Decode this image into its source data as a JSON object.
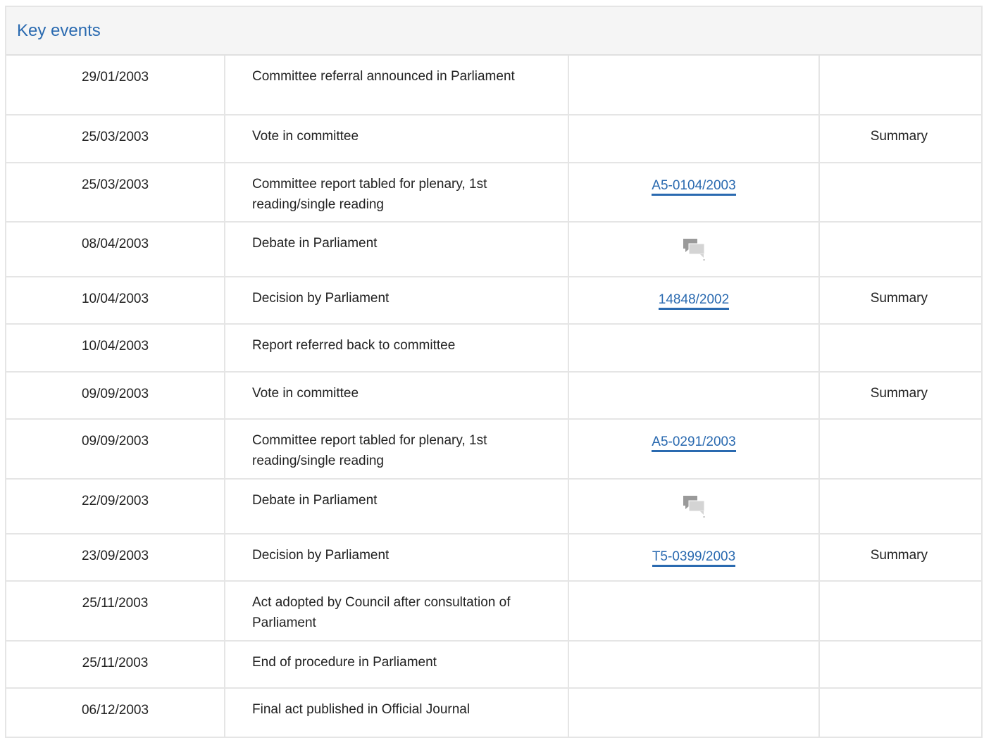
{
  "panel": {
    "title": "Key events"
  },
  "icons": {
    "debate": "debate-speech-bubbles-icon"
  },
  "colors": {
    "link": "#2a6ab0",
    "header_bg": "#f5f5f5",
    "border": "#e5e5e5"
  },
  "events": [
    {
      "date": "29/01/2003",
      "event": "Committee referral announced in Parliament",
      "reference": "",
      "debate": false,
      "summary": ""
    },
    {
      "date": "25/03/2003",
      "event": "Vote in committee",
      "reference": "",
      "debate": false,
      "summary": "Summary"
    },
    {
      "date": "25/03/2003",
      "event": "Committee report tabled for plenary, 1st reading/single reading",
      "reference": "A5-0104/2003",
      "debate": false,
      "summary": ""
    },
    {
      "date": "08/04/2003",
      "event": "Debate in Parliament",
      "reference": "",
      "debate": true,
      "summary": ""
    },
    {
      "date": "10/04/2003",
      "event": "Decision by Parliament",
      "reference": "14848/2002",
      "debate": false,
      "summary": "Summary"
    },
    {
      "date": "10/04/2003",
      "event": "Report referred back to committee",
      "reference": "",
      "debate": false,
      "summary": ""
    },
    {
      "date": "09/09/2003",
      "event": "Vote in committee",
      "reference": "",
      "debate": false,
      "summary": "Summary"
    },
    {
      "date": "09/09/2003",
      "event": "Committee report tabled for plenary, 1st reading/single reading",
      "reference": "A5-0291/2003",
      "debate": false,
      "summary": ""
    },
    {
      "date": "22/09/2003",
      "event": "Debate in Parliament",
      "reference": "",
      "debate": true,
      "summary": ""
    },
    {
      "date": "23/09/2003",
      "event": "Decision by Parliament",
      "reference": "T5-0399/2003",
      "debate": false,
      "summary": "Summary"
    },
    {
      "date": "25/11/2003",
      "event": "Act adopted by Council after consultation of Parliament",
      "reference": "",
      "debate": false,
      "summary": ""
    },
    {
      "date": "25/11/2003",
      "event": "End of procedure in Parliament",
      "reference": "",
      "debate": false,
      "summary": ""
    },
    {
      "date": "06/12/2003",
      "event": "Final act published in Official Journal",
      "reference": "",
      "debate": false,
      "summary": ""
    }
  ]
}
